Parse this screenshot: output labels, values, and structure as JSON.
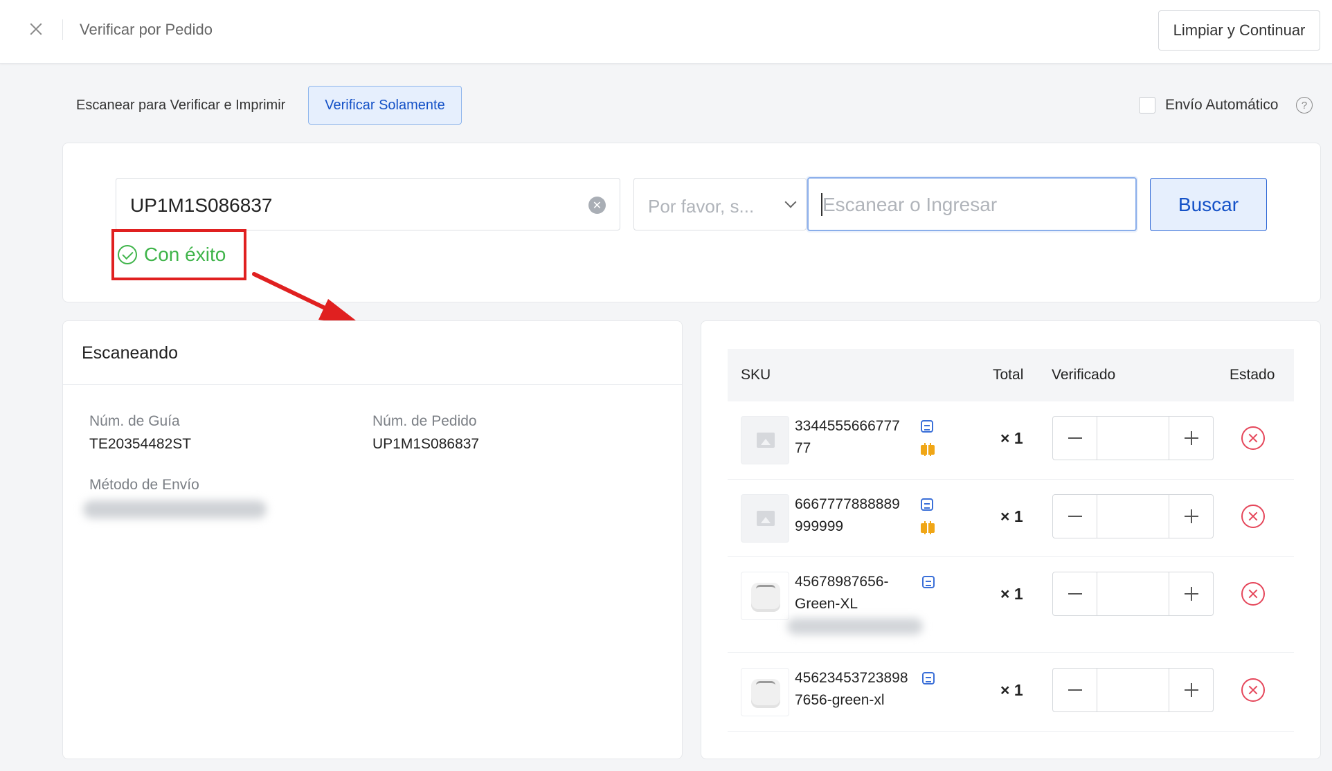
{
  "header": {
    "title": "Verificar por Pedido",
    "clear_continue_label": "Limpiar y Continuar"
  },
  "modes": {
    "scan_print_label": "Escanear para Verificar e Imprimir",
    "verify_only_label": "Verificar Solamente",
    "auto_ship_label": "Envío Automático"
  },
  "search": {
    "order_value": "UP1M1S086837",
    "success_text": "Con éxito",
    "select_placeholder": "Por favor, s...",
    "scan_placeholder": "Escanear o Ingresar",
    "search_label": "Buscar"
  },
  "scanning": {
    "title": "Escaneando",
    "guide_label": "Núm. de Guía",
    "guide_value": "TE20354482ST",
    "order_label": "Núm. de Pedido",
    "order_value": "UP1M1S086837",
    "shipping_label": "Método de Envío"
  },
  "table": {
    "col_sku": "SKU",
    "col_total": "Total",
    "col_verified": "Verificado",
    "col_status": "Estado",
    "rows": [
      {
        "sku_line1": "3344555666777",
        "sku_line2": "77",
        "qty": "× 1",
        "gift": true,
        "image": "placeholder"
      },
      {
        "sku_line1": "6667777888889",
        "sku_line2": "999999",
        "qty": "× 1",
        "gift": true,
        "image": "placeholder"
      },
      {
        "sku_line1": "45678987656-",
        "sku_line2": "Green-XL",
        "qty": "× 1",
        "gift": false,
        "image": "airpods"
      },
      {
        "sku_line1": "45623453723898",
        "sku_line2": "7656-green-xl",
        "qty": "× 1",
        "gift": false,
        "image": "airpods"
      }
    ]
  },
  "colors": {
    "accent": "#1451c7",
    "success": "#3fb44a",
    "annotation": "#e02020",
    "error": "#e5465a",
    "gift": "#f0a616"
  }
}
